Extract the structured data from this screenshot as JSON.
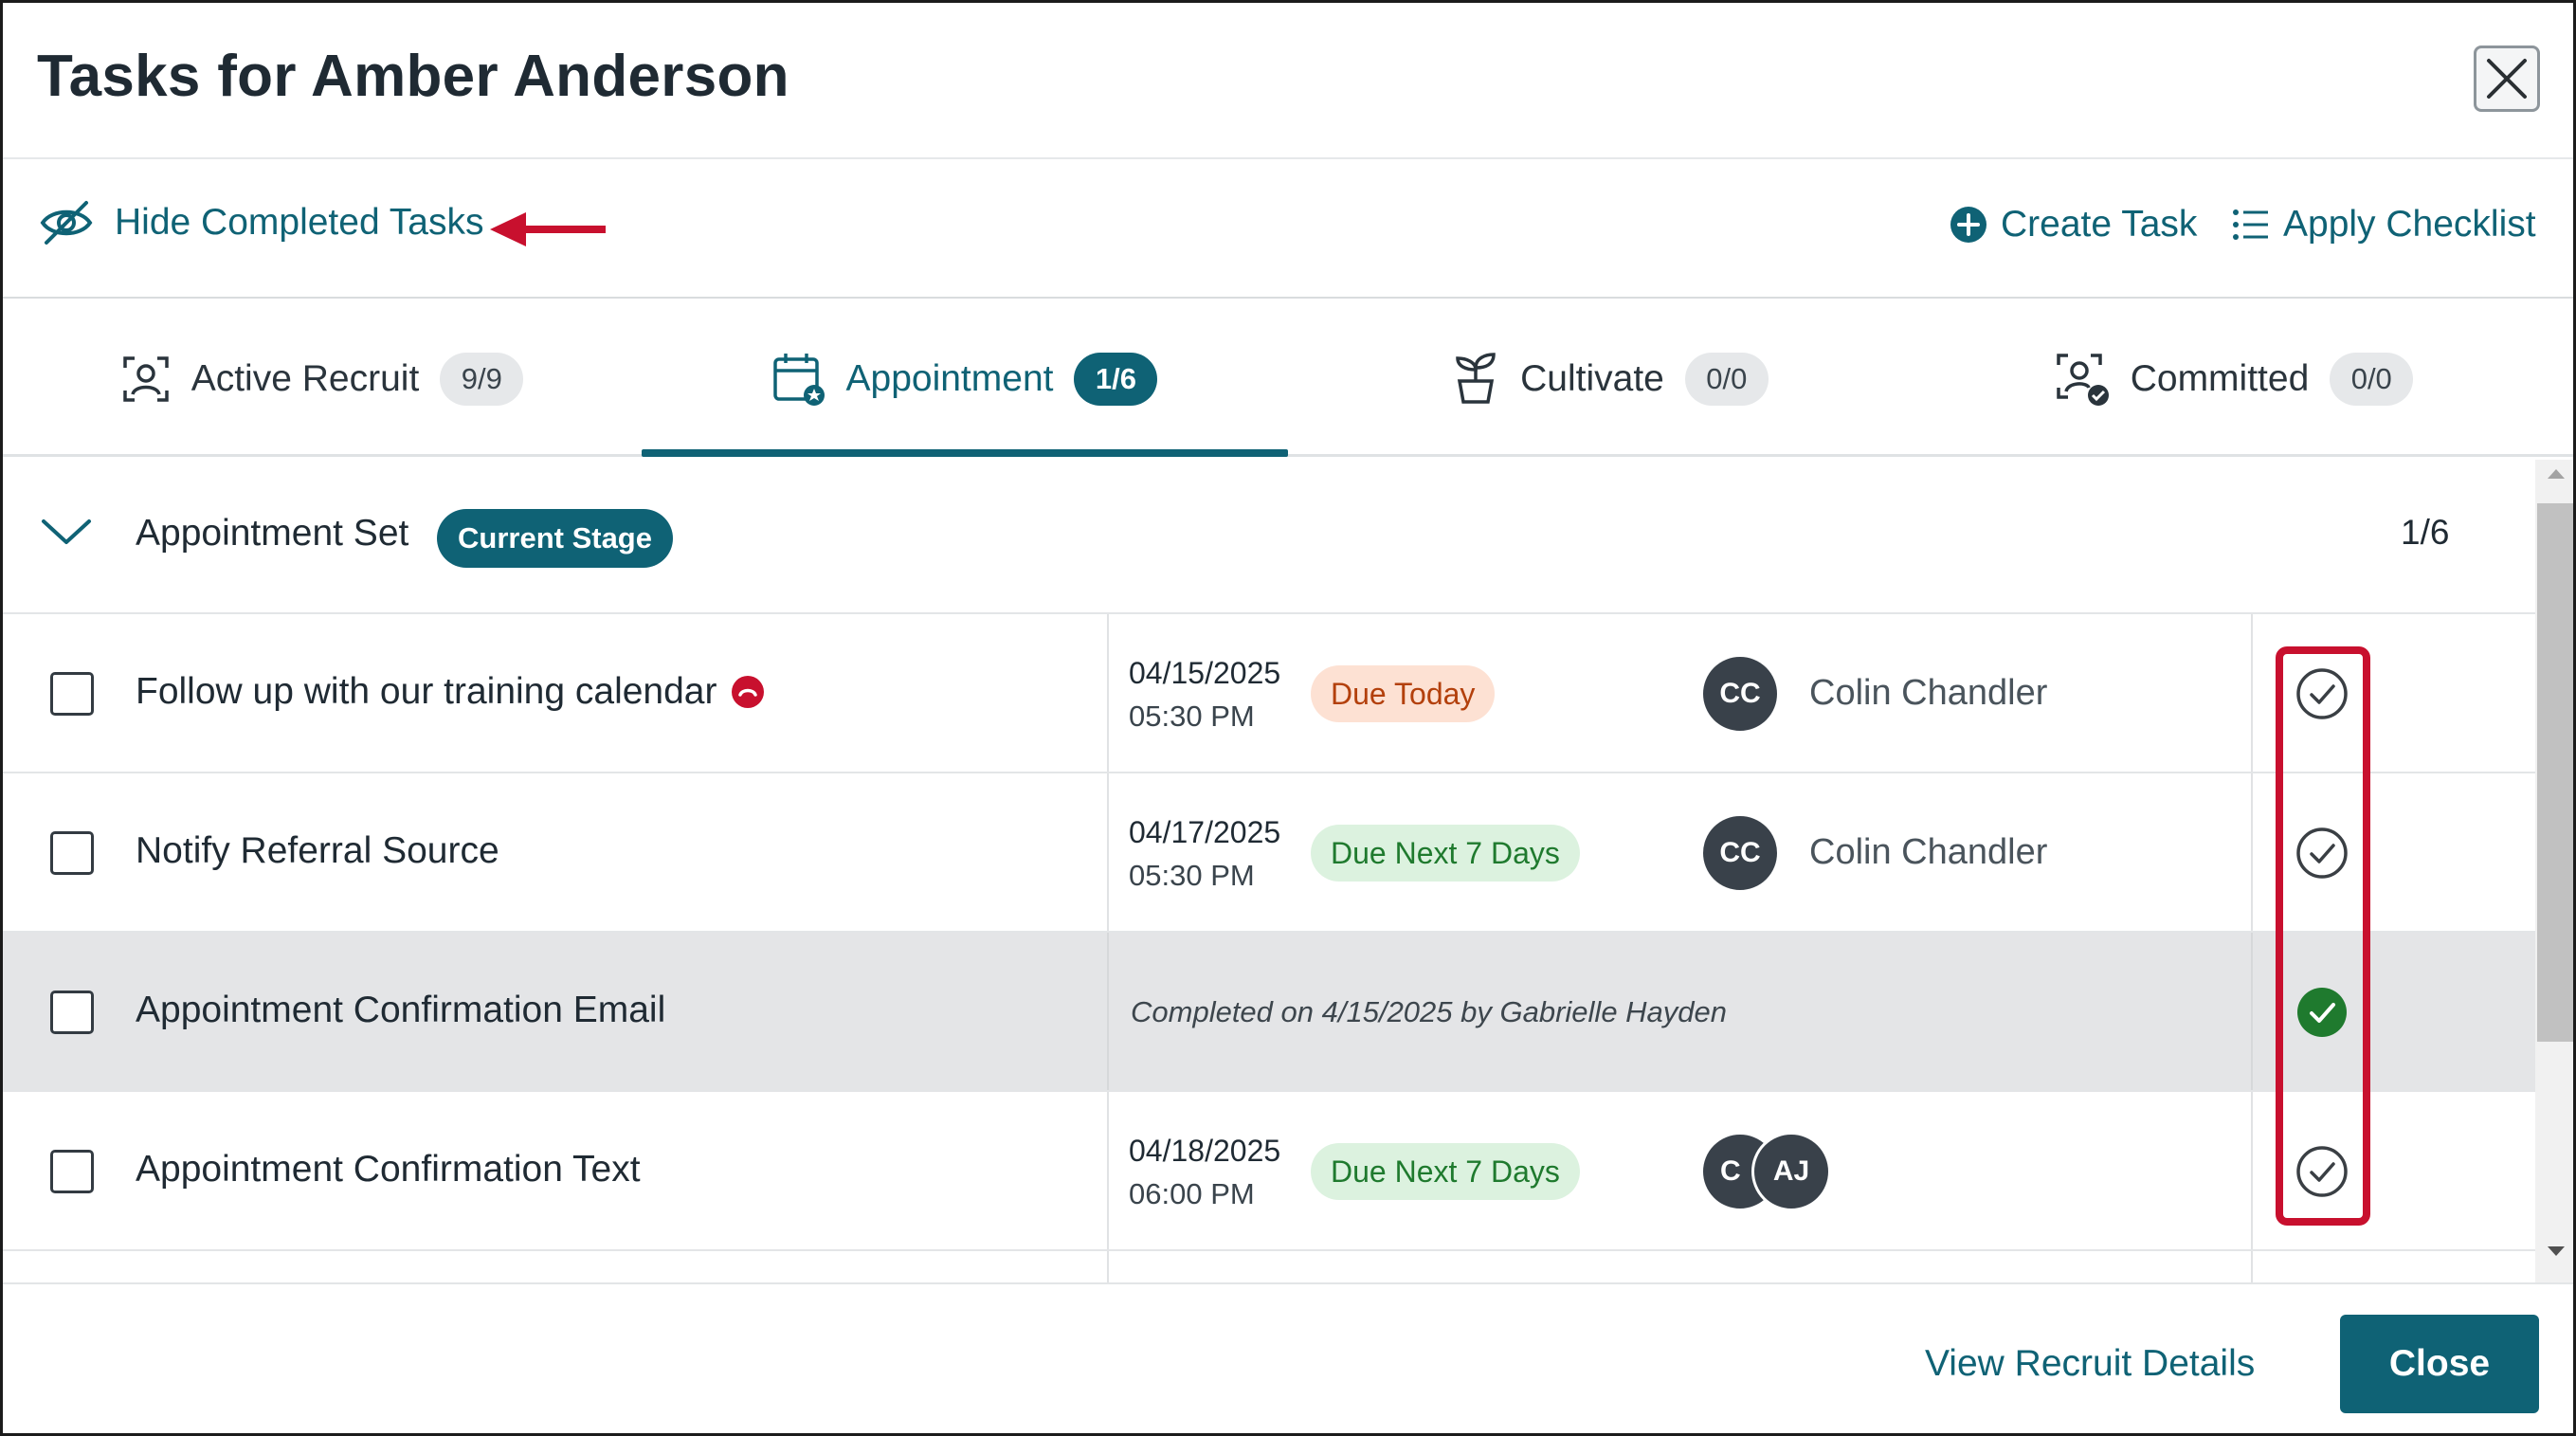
{
  "dialog": {
    "title": "Tasks for Amber Anderson"
  },
  "actions": {
    "hide_completed": "Hide Completed Tasks",
    "create_task": "Create Task",
    "apply_checklist": "Apply Checklist"
  },
  "tabs": [
    {
      "label": "Active Recruit",
      "count": "9/9",
      "icon": "person-frame-icon",
      "active": false
    },
    {
      "label": "Appointment",
      "count": "1/6",
      "icon": "calendar-star-icon",
      "active": true
    },
    {
      "label": "Cultivate",
      "count": "0/0",
      "icon": "plant-pot-icon",
      "active": false
    },
    {
      "label": "Committed",
      "count": "0/0",
      "icon": "person-check-icon",
      "active": false
    }
  ],
  "stage": {
    "name": "Appointment Set",
    "badge": "Current Stage",
    "count": "1/6"
  },
  "tasks": [
    {
      "name": "Follow up with our training calendar",
      "date": "04/15/2025",
      "time": "05:30 PM",
      "due": "Due Today",
      "avatar": "CC",
      "assignee": "Colin Chandler",
      "completed": false
    },
    {
      "name": "Notify Referral Source",
      "date": "04/17/2025",
      "time": "05:30 PM",
      "due": "Due Next 7 Days",
      "avatar": "CC",
      "assignee": "Colin Chandler",
      "completed": false
    },
    {
      "name": "Appointment Confirmation Email",
      "completed_note": "Completed on 4/15/2025 by Gabrielle Hayden",
      "completed": true
    },
    {
      "name": "Appointment Confirmation Text",
      "date": "04/18/2025",
      "time": "06:00 PM",
      "due": "Due Next 7 Days",
      "avatar": "C",
      "avatar2": "AJ",
      "completed": false
    }
  ],
  "footer": {
    "view_details": "View Recruit Details",
    "close": "Close"
  },
  "colors": {
    "brand": "#0f6275",
    "due_today_bg": "#fde1d3",
    "due_week_bg": "#dcf2df",
    "completed_check": "#1f7a2e",
    "annotation_red": "#c8102e"
  }
}
